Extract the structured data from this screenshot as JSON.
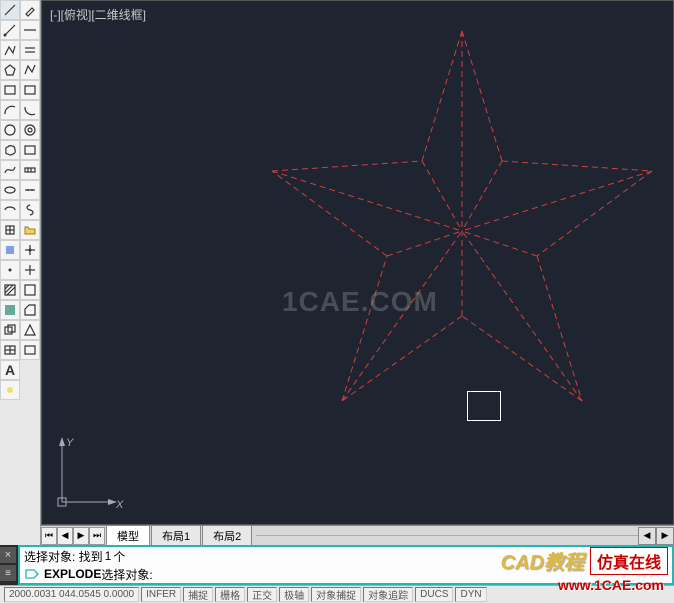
{
  "viewport_label": "[-][俯视][二维线框]",
  "watermark": "1CAE.COM",
  "ucs": {
    "x": "X",
    "y": "Y"
  },
  "tabs": {
    "model": "模型",
    "layout1": "布局1",
    "layout2": "布局2"
  },
  "command": {
    "line1_prefix": "选择对象: 找到 ",
    "line1_count": "1",
    "line1_suffix": " 个",
    "line2_cmd": "EXPLODE",
    "line2_prompt": " 选择对象:"
  },
  "status": {
    "coords": "2000.0031  044.0545   0.0000",
    "btns": [
      "INFER",
      "捕捉",
      "栅格",
      "正交",
      "极轴",
      "对象捕捉",
      "对象追踪",
      "DUCS",
      "DYN"
    ]
  },
  "overlay": {
    "cad": "CAD教程",
    "sim": "仿真在线",
    "url": "www.1CAE.com"
  },
  "icons": {
    "close": "×",
    "handle": "≡"
  }
}
